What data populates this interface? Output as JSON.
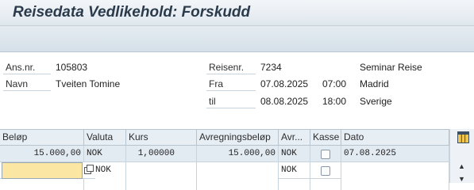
{
  "window": {
    "title": "Reisedata Vedlikehold: Forskudd"
  },
  "header": {
    "ansnr_label": "Ans.nr.",
    "ansnr_value": "105803",
    "navn_label": "Navn",
    "navn_value": "Tveiten Tomine",
    "reisenr_label": "Reisenr.",
    "reisenr_value": "7234",
    "reise_desc": "Seminar Reise",
    "fra_label": "Fra",
    "fra_date": "07.08.2025",
    "fra_time": "07:00",
    "fra_place": "Madrid",
    "til_label": "til",
    "til_date": "08.08.2025",
    "til_time": "18:00",
    "til_place": "Sverige"
  },
  "table": {
    "columns": [
      "Beløp",
      "Valuta",
      "Kurs",
      "Avregningsbeløp",
      "Avr...",
      "Kasse",
      "Dato"
    ],
    "rows": [
      {
        "belop": "15.000,00",
        "valuta": "NOK",
        "kurs": "1,00000",
        "avregning": "15.000,00",
        "avr": "NOK",
        "kasse": false,
        "dato": "07.08.2025"
      },
      {
        "belop": "",
        "valuta": "NOK",
        "kurs": "",
        "avregning": "",
        "avr": "NOK",
        "kasse": false,
        "dato": ""
      },
      {
        "belop": "",
        "valuta": "",
        "kurs": "",
        "avregning": "",
        "avr": "",
        "kasse": false,
        "dato": ""
      }
    ]
  },
  "icons": {
    "column_settings": "column-settings-icon",
    "scroll_up": "scroll-up-icon",
    "scroll_down": "scroll-down-icon",
    "value_help": "value-help-icon"
  }
}
